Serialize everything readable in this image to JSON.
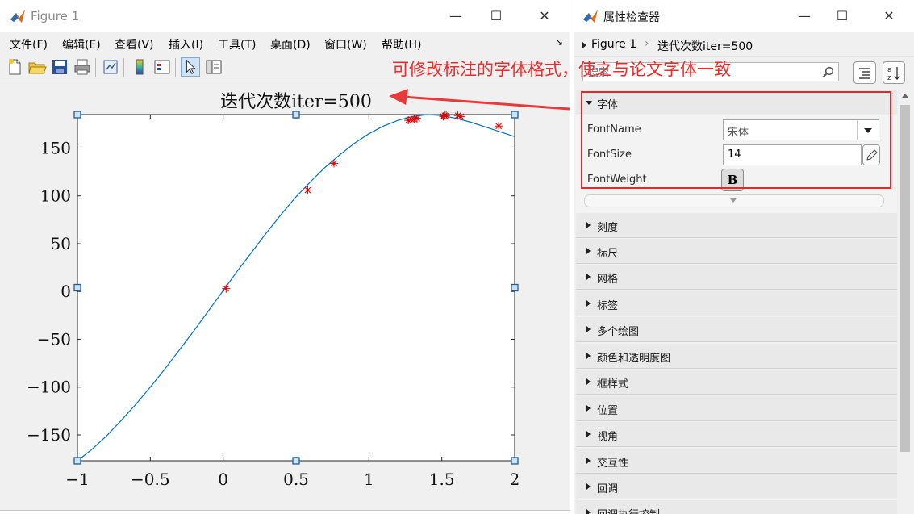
{
  "figure_window": {
    "title": "Figure 1",
    "controls": {
      "minimize": "—",
      "maximize": "☐",
      "close": "✕"
    },
    "menus": [
      "文件(F)",
      "编辑(E)",
      "查看(V)",
      "插入(I)",
      "工具(T)",
      "桌面(D)",
      "窗口(W)",
      "帮助(H)"
    ],
    "menu_arrow": "↘",
    "toolbar": [
      "new-figure",
      "open-file",
      "save",
      "print",
      "link-plot",
      "insert-colorbar",
      "insert-legend",
      "edit-plot",
      "property-inspector"
    ]
  },
  "inspector_window": {
    "title": "属性检查器",
    "breadcrumb": {
      "root": "Figure 1",
      "current": "迭代次数iter=500"
    },
    "search_placeholder": "搜索",
    "font_section": {
      "header": "字体",
      "font_name_label": "FontName",
      "font_name_value": "宋体",
      "font_size_label": "FontSize",
      "font_size_value": "14",
      "font_weight_label": "FontWeight",
      "font_weight_button": "B"
    },
    "sections": [
      "刻度",
      "标尺",
      "网格",
      "标签",
      "多个绘图",
      "颜色和透明度图",
      "框样式",
      "位置",
      "视角",
      "交互性",
      "回调",
      "回调执行控制"
    ]
  },
  "annotation": {
    "text": "可修改标注的字体格式，使之与论文字体一致",
    "color": "#ee2b2b"
  },
  "chart_data": {
    "type": "line",
    "title": "迭代次数iter=500",
    "xlabel": "",
    "ylabel": "",
    "xlim": [
      -1,
      2
    ],
    "ylim": [
      -177,
      185
    ],
    "xticks": [
      "−1",
      "−0.5",
      "0",
      "0.5",
      "1",
      "1.5",
      "2"
    ],
    "xtick_values": [
      -1,
      -0.5,
      0,
      0.5,
      1,
      1.5,
      2
    ],
    "yticks": [
      "−150",
      "−100",
      "−50",
      "0",
      "50",
      "100",
      "150"
    ],
    "ytick_values": [
      -150,
      -100,
      -50,
      0,
      50,
      100,
      150
    ],
    "curve_color": "#0072bd",
    "marker_color": "#e00000",
    "series": [
      {
        "kind": "curve",
        "x": [
          -1.0,
          -0.9,
          -0.8,
          -0.7,
          -0.6,
          -0.5,
          -0.4,
          -0.3,
          -0.2,
          -0.1,
          0.0,
          0.1,
          0.2,
          0.3,
          0.4,
          0.5,
          0.6,
          0.7,
          0.8,
          0.9,
          1.0,
          1.1,
          1.2,
          1.3,
          1.4,
          1.5,
          1.6,
          1.7,
          1.8,
          1.9,
          2.0
        ],
        "y": [
          -177,
          -165,
          -151,
          -135,
          -118,
          -100,
          -81,
          -61,
          -41,
          -20,
          1,
          22,
          42,
          62,
          81,
          99,
          115,
          130,
          143,
          155,
          165,
          173,
          179,
          183,
          185,
          184,
          181,
          177,
          172,
          167,
          162
        ]
      },
      {
        "kind": "markers",
        "x": [
          0.02,
          0.58,
          0.76,
          1.27,
          1.29,
          1.31,
          1.33,
          1.51,
          1.52,
          1.53,
          1.61,
          1.63,
          1.89
        ],
        "y": [
          3,
          106,
          134,
          179,
          180,
          180,
          181,
          183,
          184,
          184,
          184,
          183,
          173
        ]
      }
    ]
  }
}
